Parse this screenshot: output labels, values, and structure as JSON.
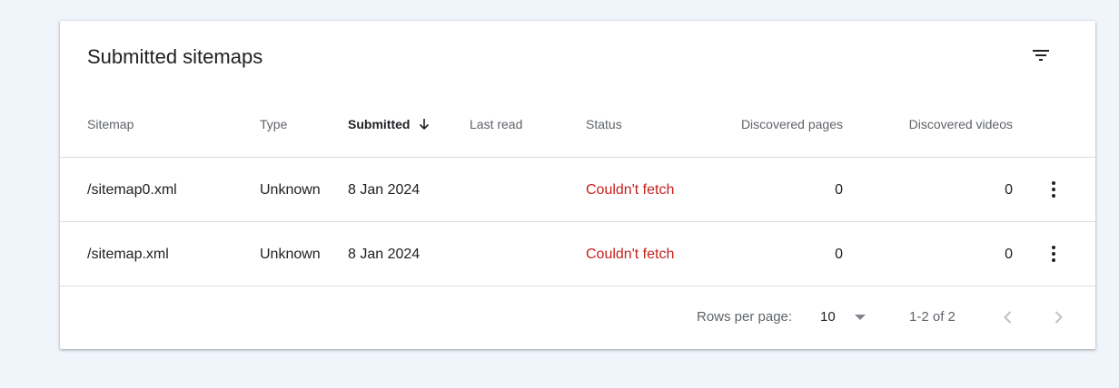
{
  "card": {
    "title": "Submitted sitemaps"
  },
  "icons": {
    "filter": "filter-icon",
    "sort": "arrow-down-icon",
    "more": "more-vert-icon",
    "dropdown": "caret-down-icon",
    "prev": "chevron-left-icon",
    "next": "chevron-right-icon"
  },
  "columns": {
    "sitemap": "Sitemap",
    "type": "Type",
    "submitted": "Submitted",
    "last_read": "Last read",
    "status": "Status",
    "discovered_pages": "Discovered pages",
    "discovered_videos": "Discovered videos"
  },
  "rows": [
    {
      "sitemap": "/sitemap0.xml",
      "type": "Unknown",
      "submitted": "8 Jan 2024",
      "last_read": "",
      "status": "Couldn't fetch",
      "discovered_pages": "0",
      "discovered_videos": "0"
    },
    {
      "sitemap": "/sitemap.xml",
      "type": "Unknown",
      "submitted": "8 Jan 2024",
      "last_read": "",
      "status": "Couldn't fetch",
      "discovered_pages": "0",
      "discovered_videos": "0"
    }
  ],
  "pagination": {
    "rows_per_page_label": "Rows per page:",
    "rows_per_page_value": "10",
    "range": "1-2 of 2"
  },
  "colors": {
    "background": "#f0f4fb",
    "error": "#c5221f",
    "divider": "#dadce0"
  }
}
